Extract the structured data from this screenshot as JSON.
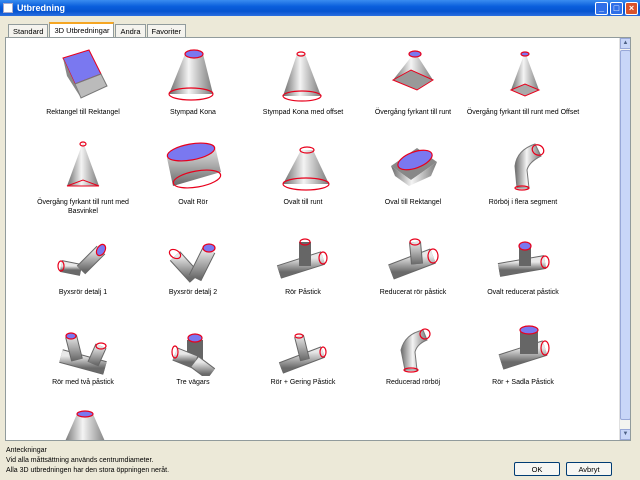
{
  "window": {
    "title": "Utbredning",
    "app_icon": "window-icon"
  },
  "tabs": [
    {
      "label": "Standard",
      "active": false
    },
    {
      "label": "3D Utbredningar",
      "active": true
    },
    {
      "label": "Andra",
      "active": false
    },
    {
      "label": "Favoriter",
      "active": false
    }
  ],
  "items": [
    {
      "label": "Rektangel till Rektangel",
      "label2": "",
      "shape": "rectbox"
    },
    {
      "label": "Stympad Kona",
      "label2": "",
      "shape": "cone"
    },
    {
      "label": "Stympad Kona med offset",
      "label2": "",
      "shape": "cone_offset"
    },
    {
      "label": "Övergång fyrkant till runt",
      "label2": "",
      "shape": "transition"
    },
    {
      "label": "Övergång fyrkant till runt med Offset",
      "label2": "",
      "shape": "transition_offset"
    },
    {
      "label": "Övergång fyrkant till runt med",
      "label2": "Basvinkel",
      "shape": "transition_tall"
    },
    {
      "label": "Ovalt Rör",
      "label2": "",
      "shape": "oval_pipe"
    },
    {
      "label": "Ovalt till runt",
      "label2": "",
      "shape": "oval_round"
    },
    {
      "label": "Oval till Rektangel",
      "label2": "",
      "shape": "oval_rect"
    },
    {
      "label": "Rörböj i flera segment",
      "label2": "",
      "shape": "elbow"
    },
    {
      "label": "Byxsrör detalj 1",
      "label2": "",
      "shape": "pants1"
    },
    {
      "label": "Byxsrör detalj 2",
      "label2": "",
      "shape": "pants2"
    },
    {
      "label": "Rör Påstick",
      "label2": "",
      "shape": "tee"
    },
    {
      "label": "Reducerat rör påstick",
      "label2": "",
      "shape": "tee_reduced"
    },
    {
      "label": "Ovalt reducerat påstick",
      "label2": "",
      "shape": "tee_oval"
    },
    {
      "label": "Rör med två påstick",
      "label2": "",
      "shape": "double_tee"
    },
    {
      "label": "Tre vägars",
      "label2": "",
      "shape": "three_way"
    },
    {
      "label": "Rör + Gering Påstick",
      "label2": "",
      "shape": "mitre_tee"
    },
    {
      "label": "Reducerad rörböj",
      "label2": "",
      "shape": "reduced_elbow"
    },
    {
      "label": "Rör + Sadla Påstick",
      "label2": "",
      "shape": "saddle_tee"
    },
    {
      "label": "",
      "label2": "",
      "shape": "cone_partial"
    }
  ],
  "notes": {
    "heading": "Anteckningar",
    "line1": "Vid alla måttsättning används centrumdiameter.",
    "line2": "Alla 3D utbredningen har den stora öppningen neråt."
  },
  "buttons": {
    "ok": "OK",
    "cancel": "Avbryt"
  },
  "colors": {
    "edge": "#e8001c",
    "face": "#7a78f0",
    "metal_dark": "#555555",
    "metal_light": "#f2f2f2"
  }
}
